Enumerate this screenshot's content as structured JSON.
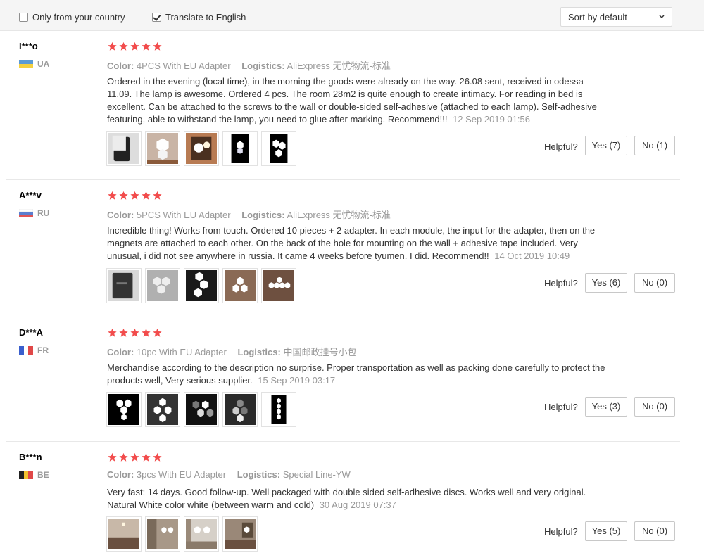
{
  "filters": {
    "only_country": {
      "label": "Only from your country",
      "checked": false
    },
    "translate": {
      "label": "Translate to English",
      "checked": true
    },
    "sort": {
      "label": "Sort by default"
    }
  },
  "labels": {
    "color": "Color:",
    "logistics": "Logistics:",
    "helpful": "Helpful?"
  },
  "colors": {
    "star": "#f24c4c",
    "accent_gray": "#999999"
  },
  "reviews": [
    {
      "user": "I***o",
      "country": "UA",
      "rating": 5,
      "color": "4PCS With EU Adapter",
      "logistics": "AliExpress 无忧物流-标准",
      "text": "Ordered in the evening (local time), in the morning the goods were already on the way. 26.08 sent, received in odessa 11.09. The lamp is awesome. Ordered 4 pcs. The room 28m2 is quite enough to create intimacy. For reading in bed is excellent. Can be attached to the screws to the wall or double-sided self-adhesive (attached to each lamp). Self-adhesive featuring, able to withstand the lamp, you need to glue after marking. Recommend!!!",
      "date": "12 Sep 2019 01:56",
      "yes": "Yes (7)",
      "no": "No (1)"
    },
    {
      "user": "A***v",
      "country": "RU",
      "rating": 5,
      "color": "5PCS With EU Adapter",
      "logistics": "AliExpress 无忧物流-标准",
      "text": "Incredible thing! Works from touch. Ordered 10 pieces + 2 adapter. In each module, the input for the adapter, then on the magnets are attached to each other. On the back of the hole for mounting on the wall + adhesive tape included. Very unusual, i did not see anywhere in russia. It came 4 weeks before tyumen. I did. Recommend!!",
      "date": "14 Oct 2019 10:49",
      "yes": "Yes (6)",
      "no": "No (0)"
    },
    {
      "user": "D***A",
      "country": "FR",
      "rating": 5,
      "color": "10pc With EU Adapter",
      "logistics": "中国邮政挂号小包",
      "text": "Merchandise according to the description no surprise. Proper transportation as well as packing done carefully to protect the products well, Very serious supplier.",
      "date": "15 Sep 2019 03:17",
      "yes": "Yes (3)",
      "no": "No (0)"
    },
    {
      "user": "B***n",
      "country": "BE",
      "rating": 5,
      "color": "3pcs With EU Adapter",
      "logistics": "Special Line-YW",
      "text": "Very fast: 14 days. Good follow-up. Well packaged with double sided self-adhesive discs. Works well and very original. Natural White color white (between warm and cold)",
      "date": "30 Aug 2019 07:37",
      "yes": "Yes (5)",
      "no": "No (0)"
    }
  ]
}
